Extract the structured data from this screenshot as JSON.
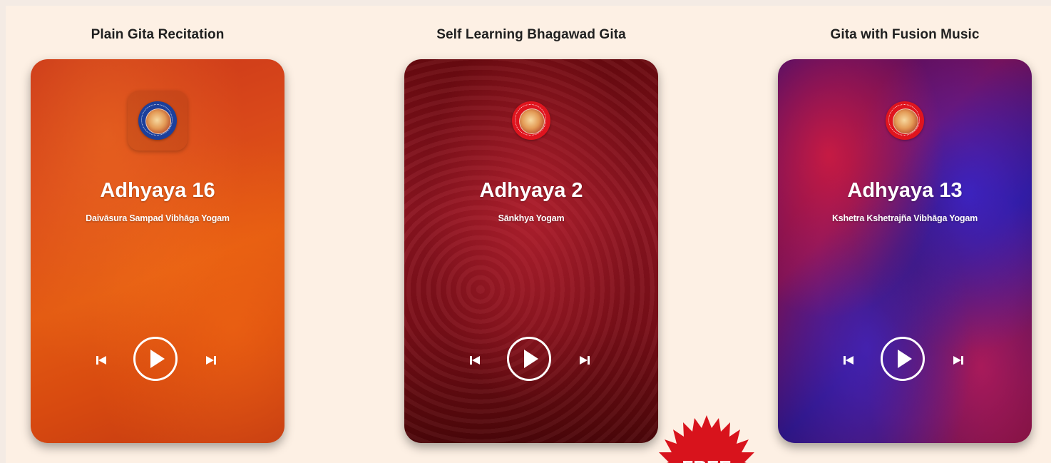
{
  "players": [
    {
      "column_title": "Plain Gita Recitation",
      "chapter": "Adhyaya 16",
      "chapter_name": "Daivāsura Sampad Vibhāga Yogam",
      "theme": "orange",
      "logo_color": "#1c3f9b"
    },
    {
      "column_title": "Self Learning Bhagawad Gita",
      "chapter": "Adhyaya 2",
      "chapter_name": "Sānkhya Yogam",
      "theme": "maroon",
      "logo_color": "#e0141e"
    },
    {
      "column_title": "Gita with Fusion Music",
      "chapter": "Adhyaya 13",
      "chapter_name": "Kshetra Kshetrajña Vibhāga Yogam",
      "theme": "fusion",
      "logo_color": "#e0141e"
    }
  ],
  "icons": {
    "logo": "gita-logo-icon",
    "prev": "skip-previous-icon",
    "play": "play-icon",
    "next": "skip-next-icon"
  },
  "badge": {
    "label": "FREE",
    "color": "#d8131c"
  },
  "colors": {
    "page_background": "#fdf0e4",
    "title_text": "#1f1f1f",
    "card_text": "#ffffff"
  }
}
